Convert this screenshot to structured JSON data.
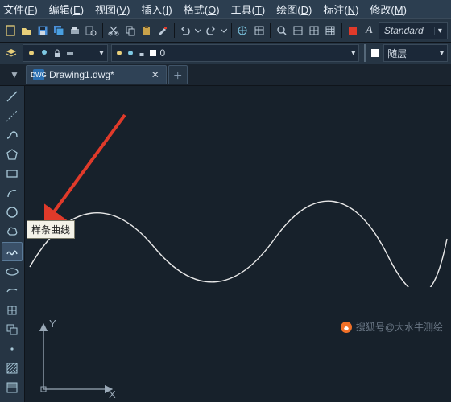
{
  "menu": {
    "file": {
      "label": "文件",
      "hot": "F"
    },
    "edit": {
      "label": "编辑",
      "hot": "E"
    },
    "view": {
      "label": "视图",
      "hot": "V"
    },
    "insert": {
      "label": "插入",
      "hot": "I"
    },
    "format": {
      "label": "格式",
      "hot": "O"
    },
    "tools": {
      "label": "工具",
      "hot": "T"
    },
    "draw": {
      "label": "绘图",
      "hot": "D"
    },
    "dim": {
      "label": "标注",
      "hot": "N"
    },
    "modify": {
      "label": "修改",
      "hot": "M"
    }
  },
  "std_toolbar": {
    "style_select": "Standard"
  },
  "layerbar": {
    "zero_label": "0",
    "suiceng_label": "随层"
  },
  "tabs": {
    "main": "Drawing1.dwg*"
  },
  "tooltip": "样条曲线",
  "watermark": "搜狐号@大水牛测绘",
  "ucs": {
    "x": "X",
    "y": "Y"
  },
  "colors": {
    "std_icon": "#bccad8",
    "draw_icon": "#a8c8d8",
    "arrow_red": "#e03a2a",
    "spline": "#e8e8e8",
    "ucs": "#9aa9b7"
  }
}
